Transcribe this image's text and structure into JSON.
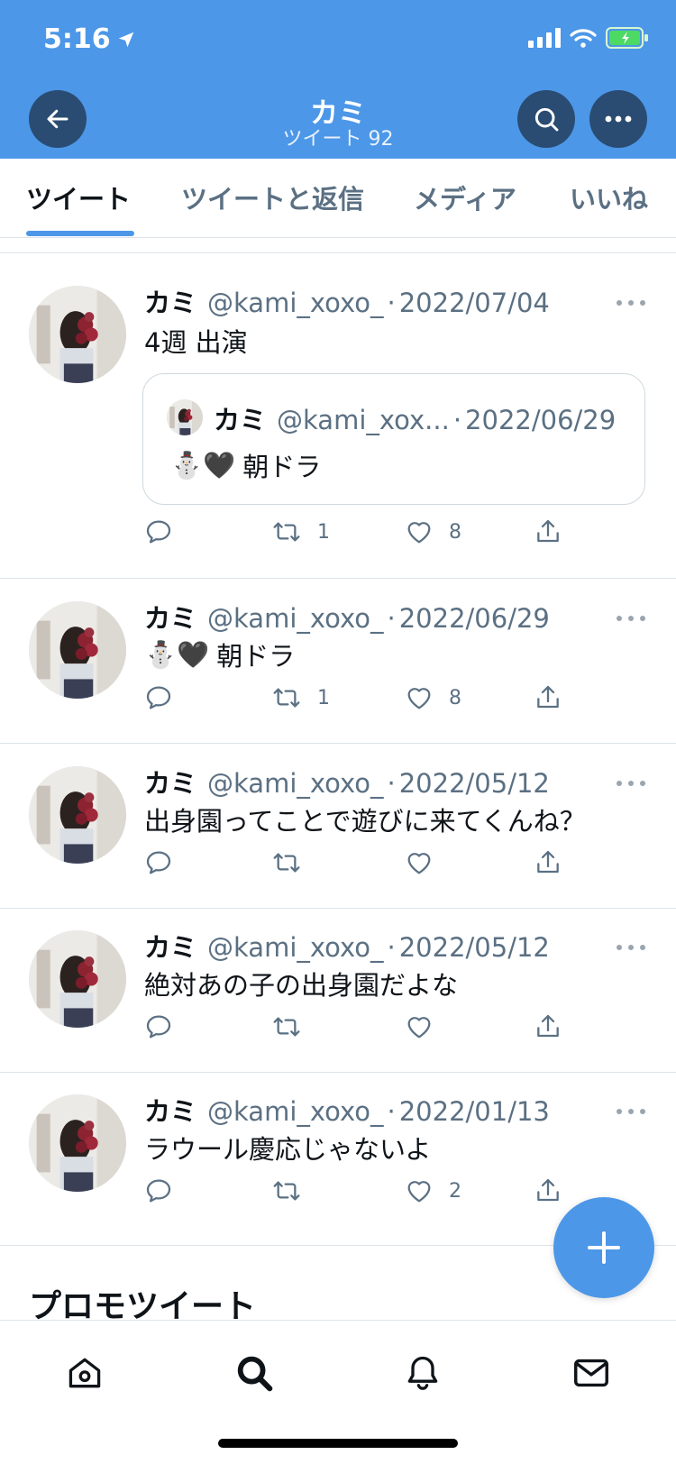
{
  "status": {
    "time": "5:16"
  },
  "header": {
    "title": "カミ",
    "subtitle": "ツイート 92"
  },
  "tabs": [
    {
      "label": "ツイート",
      "active": true
    },
    {
      "label": "ツイートと返信",
      "active": false
    },
    {
      "label": "メディア",
      "active": false
    },
    {
      "label": "いいね",
      "active": false
    }
  ],
  "tweets": [
    {
      "name": "カミ",
      "handle": "@kami_xoxo_",
      "dot": "·",
      "date": "2022/07/04",
      "text": "4週 出演",
      "quote": {
        "name": "カミ",
        "handle": "@kami_xox...",
        "dot": "·",
        "date": "2022/06/29",
        "emoji": "⛄🖤",
        "text": "朝ドラ"
      },
      "retweets": "1",
      "likes": "8"
    },
    {
      "name": "カミ",
      "handle": "@kami_xoxo_",
      "dot": "·",
      "date": "2022/06/29",
      "emoji": "⛄🖤",
      "text": "朝ドラ",
      "retweets": "1",
      "likes": "8"
    },
    {
      "name": "カミ",
      "handle": "@kami_xoxo_",
      "dot": "·",
      "date": "2022/05/12",
      "text": "出身園ってことで遊びに来てくんね？",
      "retweets": "",
      "likes": ""
    },
    {
      "name": "カミ",
      "handle": "@kami_xoxo_",
      "dot": "·",
      "date": "2022/05/12",
      "text": "絶対あの子の出身園だよな",
      "retweets": "",
      "likes": ""
    },
    {
      "name": "カミ",
      "handle": "@kami_xoxo_",
      "dot": "·",
      "date": "2022/01/13",
      "text": "ラウール慶応じゃないよ",
      "retweets": "",
      "likes": "2"
    }
  ],
  "promo": {
    "title": "プロモツイート"
  },
  "colors": {
    "accent": "#4c97e8",
    "header_button": "#2a4c72",
    "secondary_text": "#5b7083"
  },
  "icons": {
    "back": "arrow-left-icon",
    "search": "search-icon",
    "more": "more-horizontal-icon",
    "reply": "reply-icon",
    "retweet": "retweet-icon",
    "like": "heart-icon",
    "share": "share-icon",
    "compose": "plus-icon",
    "nav": [
      "home-icon",
      "search-icon",
      "bell-icon",
      "mail-icon"
    ]
  }
}
